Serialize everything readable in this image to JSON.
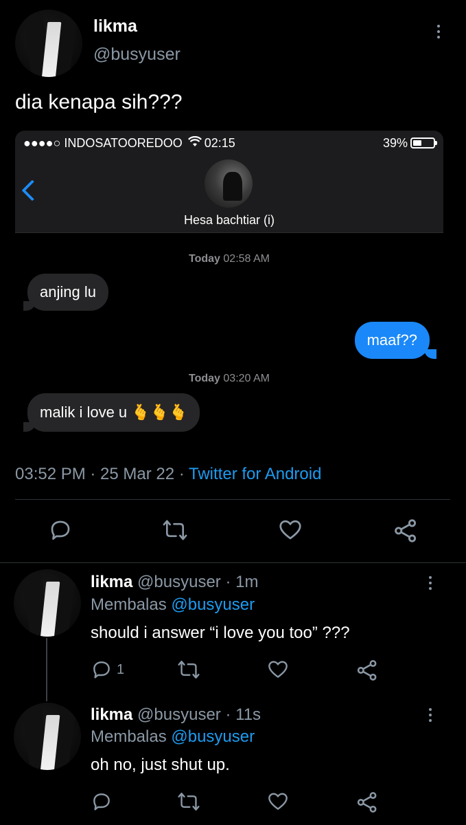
{
  "main_tweet": {
    "display_name": "likma",
    "handle": "@busyuser",
    "text": "dia kenapa sih???",
    "meta_time": "03:52 PM · 25 Mar 22 · ",
    "meta_source": "Twitter for Android"
  },
  "embedded_screenshot": {
    "carrier": "●●●●○ INDOSATOOREDOO",
    "time": "02:15",
    "battery": "39%",
    "contact_name": "Hesa bachtiar (i)",
    "messages": [
      {
        "type": "timestamp",
        "day": "Today",
        "time": "02:58 AM"
      },
      {
        "type": "incoming",
        "text": "anjing lu"
      },
      {
        "type": "outgoing",
        "text": "maaf??"
      },
      {
        "type": "timestamp",
        "day": "Today",
        "time": "03:20 AM"
      },
      {
        "type": "incoming",
        "text": "malik i love u 🫰🫰🫰"
      }
    ]
  },
  "replies": [
    {
      "display_name": "likma",
      "handle_time": "@busyuser · 1m",
      "replying_label": "Membalas ",
      "replying_to": "@busyuser",
      "text": "should i answer “i love you too” ???",
      "reply_count": "1"
    },
    {
      "display_name": "likma",
      "handle_time": "@busyuser · 11s",
      "replying_label": "Membalas ",
      "replying_to": "@busyuser",
      "text": "oh no, just shut up.",
      "reply_count": ""
    }
  ],
  "icons": {
    "reply": "reply-icon",
    "retweet": "retweet-icon",
    "like": "heart-icon",
    "share": "share-icon",
    "more": "more-icon"
  },
  "colors": {
    "background": "#000000",
    "link": "#1d9bf0",
    "muted": "#8b98a5",
    "imessage_blue": "#1a88f8",
    "incoming_bubble": "#262628"
  }
}
